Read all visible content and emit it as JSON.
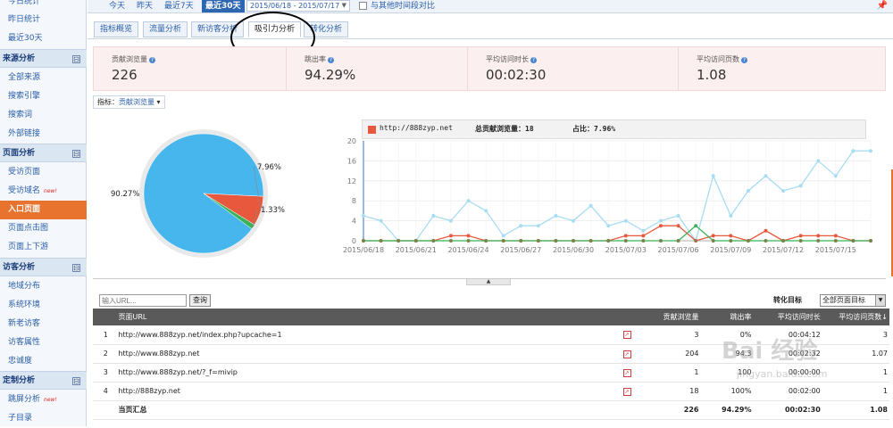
{
  "sidebar": {
    "top_items": [
      "今日统计",
      "昨日统计",
      "最近30天"
    ],
    "sections": [
      {
        "title": "来源分析",
        "items": [
          "全部来源",
          "搜索引擎",
          "搜索词",
          "外部链接"
        ]
      },
      {
        "title": "页面分析",
        "items": [
          "受访页面",
          "受访域名",
          "入口页面",
          "页面点击图",
          "页面上下游"
        ]
      },
      {
        "title": "访客分析",
        "items": [
          "地域分布",
          "系统环境",
          "新老访客",
          "访客属性",
          "忠诚度"
        ]
      },
      {
        "title": "定制分析",
        "items": [
          "跳屏分析",
          "子目录"
        ]
      }
    ],
    "new_tag": "new!",
    "toggle_symbol": "⊟"
  },
  "topbar": {
    "today": "今天",
    "yesterday": "昨天",
    "last7": "最近7天",
    "last30": "最近30天",
    "date_range": "2015/06/18 - 2015/07/17",
    "compare_label": "与其他时间段对比"
  },
  "tabs": [
    "指标概览",
    "流量分析",
    "新访客分析",
    "吸引力分析",
    "转化分析"
  ],
  "kpi": [
    {
      "label": "贡献浏览量",
      "value": "226"
    },
    {
      "label": "跳出率",
      "value": "94.29%"
    },
    {
      "label": "平均访问时长",
      "value": "00:02:30"
    },
    {
      "label": "平均访问页数",
      "value": "1.08"
    }
  ],
  "metric_select": {
    "label": "指标：",
    "value": "贡献浏览量"
  },
  "legend": {
    "site": "http://888zyp.net",
    "pv_label": "总贡献浏览量：18",
    "share_label": "占比：7.96%"
  },
  "chart_data": [
    {
      "type": "pie",
      "slices": [
        {
          "label": "90.27%",
          "value": 90.27,
          "color": "#46b6ec"
        },
        {
          "label": "7.96%",
          "value": 7.96,
          "color": "#e8583d"
        },
        {
          "label": "1.33%",
          "value": 1.33,
          "color": "#3bb25a"
        }
      ]
    },
    {
      "type": "line",
      "x": [
        "2015/06/18",
        "2015/06/19",
        "2015/06/20",
        "2015/06/21",
        "2015/06/22",
        "2015/06/23",
        "2015/06/24",
        "2015/06/25",
        "2015/06/26",
        "2015/06/27",
        "2015/06/28",
        "2015/06/29",
        "2015/06/30",
        "2015/07/01",
        "2015/07/02",
        "2015/07/03",
        "2015/07/04",
        "2015/07/05",
        "2015/07/06",
        "2015/07/07",
        "2015/07/08",
        "2015/07/09",
        "2015/07/10",
        "2015/07/11",
        "2015/07/12",
        "2015/07/13",
        "2015/07/14",
        "2015/07/15",
        "2015/07/16",
        "2015/07/17"
      ],
      "xticks": [
        "2015/06/18",
        "2015/06/21",
        "2015/06/24",
        "2015/06/27",
        "2015/06/30",
        "2015/07/03",
        "2015/07/06",
        "2015/07/09",
        "2015/07/12",
        "2015/07/15"
      ],
      "ylim": [
        0,
        20
      ],
      "yticks": [
        0,
        4,
        8,
        12,
        16,
        20
      ],
      "series": [
        {
          "color": "#a8dcf3",
          "values": [
            5,
            4,
            0,
            0,
            5,
            4,
            8,
            6,
            1,
            3,
            3,
            5,
            4,
            7,
            3,
            4,
            2,
            4,
            5,
            0,
            13,
            5,
            10,
            13,
            10,
            11,
            16,
            13,
            18,
            18
          ]
        },
        {
          "color": "#e8583d",
          "values": [
            0,
            0,
            0,
            0,
            0,
            1,
            1,
            0,
            0,
            0,
            0,
            0,
            0,
            0,
            0,
            1,
            1,
            3,
            3,
            0,
            1,
            1,
            0,
            2,
            0,
            1,
            1,
            1,
            0,
            0
          ]
        },
        {
          "color": "#3bb25a",
          "values": [
            0,
            0,
            0,
            0,
            0,
            0,
            0,
            0,
            0,
            0,
            0,
            0,
            0,
            0,
            0,
            0,
            0,
            0,
            0,
            3,
            0,
            0,
            0,
            0,
            0,
            0,
            0,
            0,
            0,
            0
          ]
        }
      ]
    }
  ],
  "filter": {
    "url_placeholder": "输入URL...",
    "query_button": "查询",
    "goal_label": "转化目标",
    "goal_value": "全部页面目标"
  },
  "table": {
    "headers": [
      "页面URL",
      "贡献浏览量",
      "跳出率",
      "平均访问时长",
      "平均访问页数"
    ],
    "rows": [
      {
        "idx": "1",
        "url": "http://www.888zyp.net/index.php?upcache=1",
        "pv": "3",
        "bounce": "0%",
        "time": "00:04:12",
        "pages": "3"
      },
      {
        "idx": "2",
        "url": "http://www.888zyp.net",
        "pv": "204",
        "bounce": "94.3",
        "time": "00:02:32",
        "pages": "1.07"
      },
      {
        "idx": "3",
        "url": "http://www.888zyp.net/?_f=mivip",
        "pv": "1",
        "bounce": "100",
        "time": "00:00:00",
        "pages": "1"
      },
      {
        "idx": "4",
        "url": "http://888zyp.net",
        "pv": "18",
        "bounce": "100%",
        "time": "00:02:00",
        "pages": "1"
      }
    ],
    "summary": {
      "label": "当页汇总",
      "pv": "226",
      "bounce": "94.29%",
      "time": "00:02:30",
      "pages": "1.08"
    }
  },
  "watermark": {
    "text": "Bai 经验",
    "sub": "jingyan.baidu.com"
  }
}
